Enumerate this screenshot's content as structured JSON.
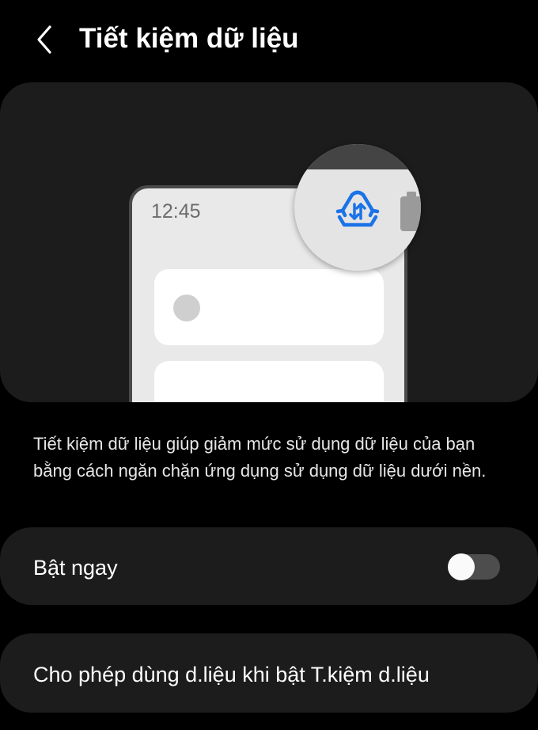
{
  "header": {
    "title": "Tiết kiệm dữ liệu",
    "back_icon": "chevron-left-icon"
  },
  "illustration": {
    "phone_time": "12:45",
    "status_icon": "data-saver-icon",
    "accent_color": "#1a73e8"
  },
  "description": "Tiết kiệm dữ liệu giúp giảm mức sử dụng dữ liệu của bạn bằng cách ngăn chặn ứng dụng sử dụng dữ liệu dưới nền.",
  "settings": {
    "turn_on": {
      "label": "Bật ngay",
      "enabled": false
    },
    "allow_apps": {
      "label": "Cho phép dùng d.liệu khi bật T.kiệm d.liệu"
    }
  }
}
